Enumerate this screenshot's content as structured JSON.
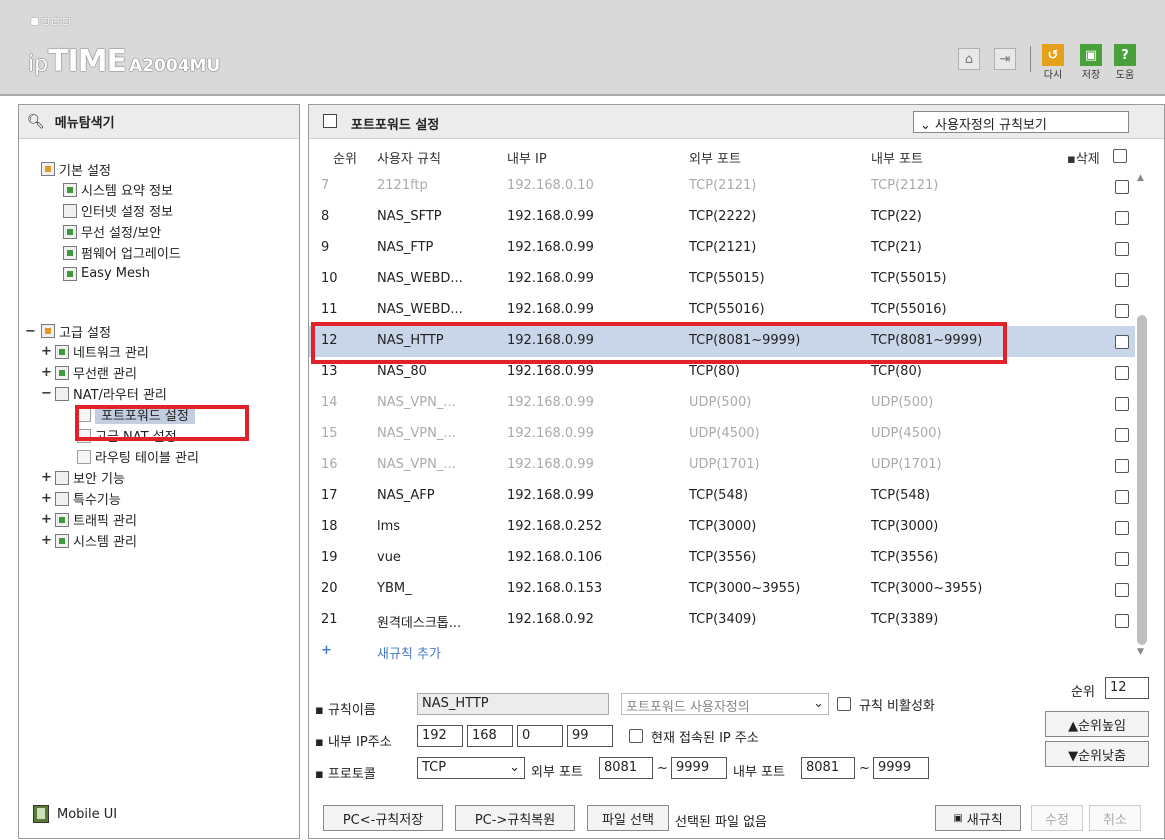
{
  "header": {
    "brand_dots": "▪▫▫▫",
    "brand_ip": "ip",
    "brand_time": "TIME",
    "brand_model": "A2004MU",
    "buttons": [
      {
        "label": "다시",
        "color": "#e6a11a"
      },
      {
        "label": "저장",
        "color": "#4aa03a"
      },
      {
        "label": "도움",
        "color": "#4aa03a"
      }
    ]
  },
  "left": {
    "title": "메뉴탐색기",
    "basic": {
      "label": "기본 설정",
      "items": [
        "시스템 요약 정보",
        "인터넷 설정 정보",
        "무선 설정/보안",
        "펌웨어 업그레이드",
        "Easy Mesh"
      ]
    },
    "advanced": {
      "label": "고급 설정",
      "items": [
        {
          "label": "네트워크 관리",
          "toggle": "+"
        },
        {
          "label": "무선랜 관리",
          "toggle": "+"
        },
        {
          "label": "NAT/라우터 관리",
          "toggle": "−"
        }
      ],
      "nat_children": [
        "포트포워드 설정",
        "고급 NAT 설정",
        "라우팅 테이블 관리"
      ],
      "more": [
        {
          "label": "보안 기능",
          "toggle": "+"
        },
        {
          "label": "특수기능",
          "toggle": "+"
        },
        {
          "label": "트래픽 관리",
          "toggle": "+"
        },
        {
          "label": "시스템 관리",
          "toggle": "+"
        }
      ]
    },
    "mobile_ui": "Mobile UI"
  },
  "right": {
    "title": "포트포워드 설정",
    "view_select": "사용자정의 규칙보기",
    "columns": {
      "seq": "순위",
      "rule": "사용자 규칙",
      "internal_ip": "내부 IP",
      "external_port": "외부 포트",
      "internal_port": "내부 포트",
      "delete": "삭제"
    },
    "rows": [
      {
        "seq": "7",
        "rule": "2121ftp",
        "ip": "192.168.0.10",
        "ext": "TCP(2121)",
        "int": "TCP(2121)",
        "dim": true
      },
      {
        "seq": "8",
        "rule": "NAS_SFTP",
        "ip": "192.168.0.99",
        "ext": "TCP(2222)",
        "int": "TCP(22)",
        "dim": false
      },
      {
        "seq": "9",
        "rule": "NAS_FTP",
        "ip": "192.168.0.99",
        "ext": "TCP(2121)",
        "int": "TCP(21)",
        "dim": false
      },
      {
        "seq": "10",
        "rule": "NAS_WEBD...",
        "ip": "192.168.0.99",
        "ext": "TCP(55015)",
        "int": "TCP(55015)",
        "dim": false
      },
      {
        "seq": "11",
        "rule": "NAS_WEBD...",
        "ip": "192.168.0.99",
        "ext": "TCP(55016)",
        "int": "TCP(55016)",
        "dim": false
      },
      {
        "seq": "12",
        "rule": "NAS_HTTP",
        "ip": "192.168.0.99",
        "ext": "TCP(8081~9999)",
        "int": "TCP(8081~9999)",
        "dim": false,
        "selected": true
      },
      {
        "seq": "13",
        "rule": "NAS_80",
        "ip": "192.168.0.99",
        "ext": "TCP(80)",
        "int": "TCP(80)",
        "dim": false
      },
      {
        "seq": "14",
        "rule": "NAS_VPN_...",
        "ip": "192.168.0.99",
        "ext": "UDP(500)",
        "int": "UDP(500)",
        "dim": true
      },
      {
        "seq": "15",
        "rule": "NAS_VPN_...",
        "ip": "192.168.0.99",
        "ext": "UDP(4500)",
        "int": "UDP(4500)",
        "dim": true
      },
      {
        "seq": "16",
        "rule": "NAS_VPN_...",
        "ip": "192.168.0.99",
        "ext": "UDP(1701)",
        "int": "UDP(1701)",
        "dim": true
      },
      {
        "seq": "17",
        "rule": "NAS_AFP",
        "ip": "192.168.0.99",
        "ext": "TCP(548)",
        "int": "TCP(548)",
        "dim": false
      },
      {
        "seq": "18",
        "rule": "lms",
        "ip": "192.168.0.252",
        "ext": "TCP(3000)",
        "int": "TCP(3000)",
        "dim": false
      },
      {
        "seq": "19",
        "rule": "vue",
        "ip": "192.168.0.106",
        "ext": "TCP(3556)",
        "int": "TCP(3556)",
        "dim": false
      },
      {
        "seq": "20",
        "rule": "YBM_",
        "ip": "192.168.0.153",
        "ext": "TCP(3000~3955)",
        "int": "TCP(3000~3955)",
        "dim": false
      },
      {
        "seq": "21",
        "rule": "원격데스크톱...",
        "ip": "192.168.0.92",
        "ext": "TCP(3409)",
        "int": "TCP(3389)",
        "dim": false
      }
    ],
    "add_rule": "새규칙 추가",
    "form": {
      "rule_name_label": "규칙이름",
      "rule_name_value": "NAS_HTTP",
      "rule_type_select": "포트포워드 사용자정의",
      "disable_label": "규칙 비활성화",
      "ip_label": "내부 IP주소",
      "ip": [
        "192",
        "168",
        "0",
        "99"
      ],
      "current_ip_label": "현재 접속된 IP 주소",
      "protocol_label": "프로토콜",
      "protocol_value": "TCP",
      "ext_port_label": "외부 포트",
      "ext_port_from": "8081",
      "ext_port_to": "9999",
      "int_port_label": "내부 포트",
      "int_port_from": "8081",
      "int_port_to": "9999",
      "seq_label": "순위",
      "seq_value": "12",
      "rank_up": "▲순위높임",
      "rank_down": "▼순위낮춤"
    },
    "footer": {
      "save_to_pc": "PC<-규칙저장",
      "restore_from_pc": "PC->규칙복원",
      "file_select": "파일 선택",
      "file_none": "선택된 파일 없음",
      "new_rule": "새규칙",
      "modify": "수정",
      "cancel": "취소"
    }
  }
}
